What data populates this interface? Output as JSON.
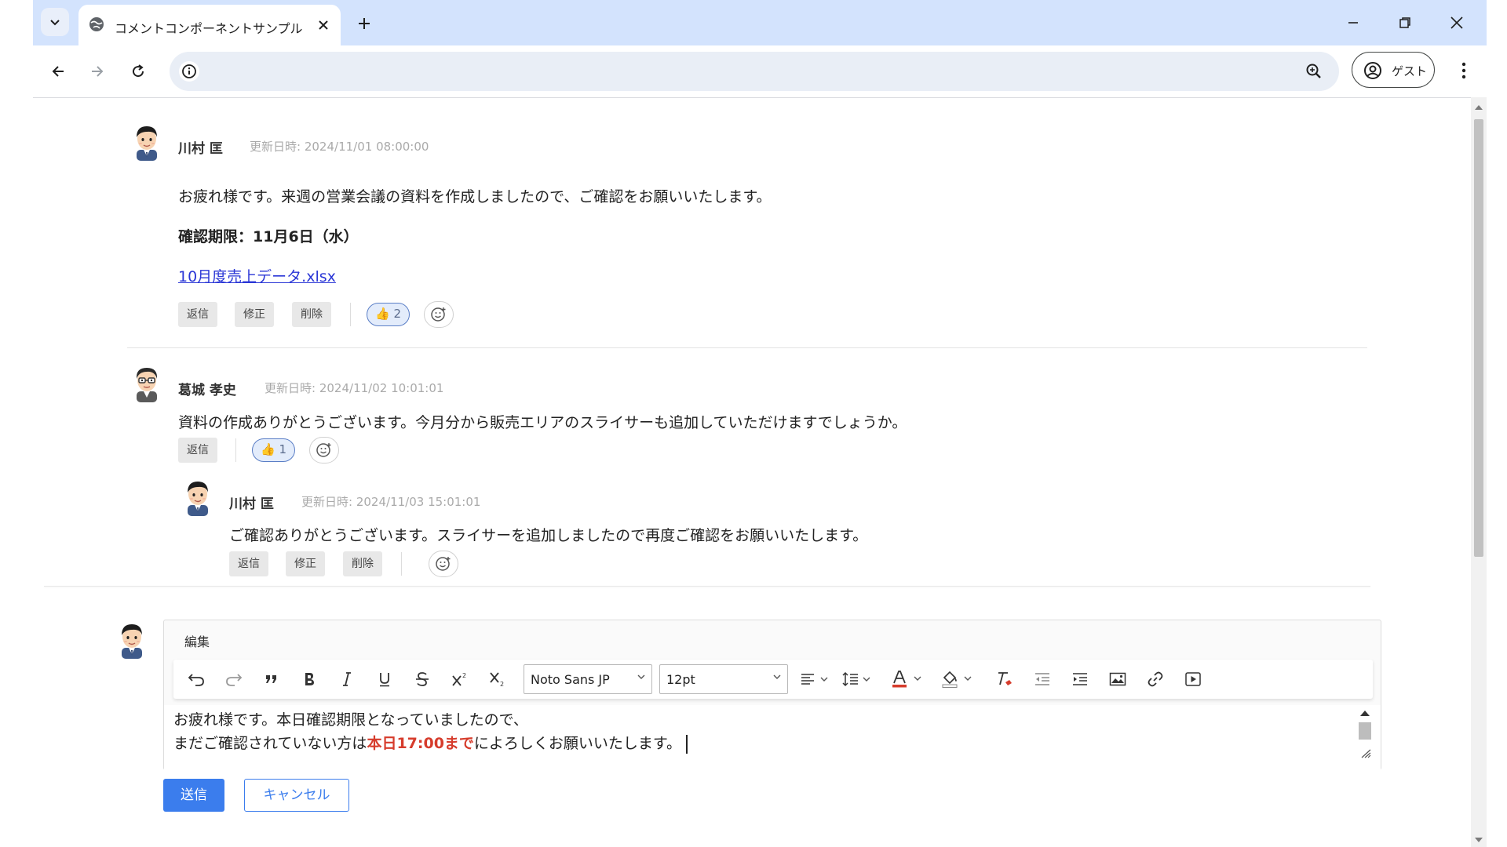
{
  "browser": {
    "tab_title": "コメントコンポーネントサンプル",
    "profile_label": "ゲスト",
    "address": ""
  },
  "comments": [
    {
      "author": "川村 匡",
      "updated_label": "更新日時:",
      "updated_at": "2024/11/01 08:00:00",
      "body": "お疲れ様です。来週の営業会議の資料を作成しましたので、ご確認をお願いいたします。",
      "deadline": "確認期限：11月6日（水）",
      "attachment": "10月度売上データ.xlsx",
      "actions": [
        "返信",
        "修正",
        "削除"
      ],
      "reaction": {
        "emoji": "👍",
        "count": "2"
      }
    },
    {
      "author": "葛城 孝史",
      "updated_label": "更新日時:",
      "updated_at": "2024/11/02 10:01:01",
      "body": "資料の作成ありがとうございます。今月分から販売エリアのスライサーも追加していただけますでしょうか。",
      "actions": [
        "返信"
      ],
      "reaction": {
        "emoji": "👍",
        "count": "1"
      }
    },
    {
      "author": "川村 匡",
      "updated_label": "更新日時:",
      "updated_at": "2024/11/03 15:01:01",
      "body": "ご確認ありがとうございます。スライサーを追加しましたので再度ご確認をお願いいたします。",
      "actions": [
        "返信",
        "修正",
        "削除"
      ]
    }
  ],
  "editor": {
    "menu_label": "編集",
    "font_family": "Noto Sans JP",
    "font_size": "12pt",
    "text_color": "#d63c2c",
    "line1": "お疲れ様です。本日確認期限となっていましたので、",
    "line2_before": "まだご確認されていない方は",
    "line2_highlight": "本日17:00まで",
    "line2_after": "によろしくお願いいたします。",
    "submit_label": "送信",
    "cancel_label": "キャンセル"
  },
  "colors": {
    "tabbar": "#d3e3fd",
    "primary": "#3b7ded",
    "highlight": "#d63c2c",
    "link": "#2a36d6"
  }
}
